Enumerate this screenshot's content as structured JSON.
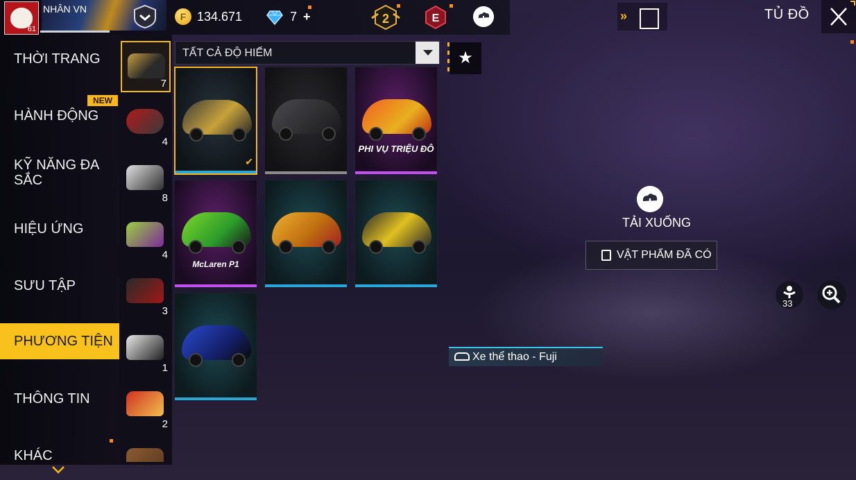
{
  "topbar": {
    "player_name": "NHÂN    VN",
    "player_level": "61",
    "gold": "134.671",
    "diamonds": "7",
    "diamond_plus": "+",
    "rank_badge_number": "2",
    "e_badge_letter": "E",
    "title": "TỦ ĐỒ",
    "icons": [
      "rank-shield-icon",
      "gold-coin-icon",
      "diamond-icon",
      "rank-badge-icon",
      "e-badge-icon",
      "cloud-download-icon",
      "double-arrow-icon",
      "character-icon",
      "close-icon"
    ]
  },
  "sidebar": {
    "items": [
      {
        "label": "THỜI TRANG"
      },
      {
        "label": "HÀNH ĐỘNG",
        "badge": "NEW"
      },
      {
        "label": "KỸ NĂNG ĐA SẮC"
      },
      {
        "label": "HIỆU ỨNG"
      },
      {
        "label": "SƯU TẬP"
      },
      {
        "label": "PHƯƠNG TIỆN",
        "active": true
      },
      {
        "label": "THÔNG TIN"
      },
      {
        "label": "KHÁC"
      }
    ]
  },
  "vehicle_types": [
    {
      "kind": "sports-car",
      "count": "7",
      "active": true
    },
    {
      "kind": "motorbike",
      "count": "4"
    },
    {
      "kind": "monster-truck",
      "count": "8"
    },
    {
      "kind": "van",
      "count": "4"
    },
    {
      "kind": "jeep",
      "count": "3"
    },
    {
      "kind": "quad-bike",
      "count": "1"
    },
    {
      "kind": "tuk-tuk",
      "count": "2"
    },
    {
      "kind": "horse",
      "count": ""
    }
  ],
  "filter": {
    "label": "TẤT CẢ ĐỘ HIẾM"
  },
  "grid": {
    "cards": [
      {
        "caption": "",
        "selected": true
      },
      {
        "caption": ""
      },
      {
        "caption": "PHI VỤ TRIỆU ĐÔ"
      },
      {
        "caption": "McLaren P1"
      },
      {
        "caption": ""
      },
      {
        "caption": ""
      },
      {
        "caption": ""
      }
    ]
  },
  "panel": {
    "download_label": "TẢI XUỐNG",
    "owned_label": "VẬT PHẨM ĐÃ CÓ",
    "pose_count": "33",
    "vehicle_name": "Xe thể thao - Fuji"
  },
  "colors": {
    "accent": "#f8c11c",
    "highlight_cyan": "#36c4e8",
    "rarity_purple": "#c34ff0",
    "rarity_blue": "#2aa6d8",
    "rarity_grey": "#8c8c8c"
  }
}
